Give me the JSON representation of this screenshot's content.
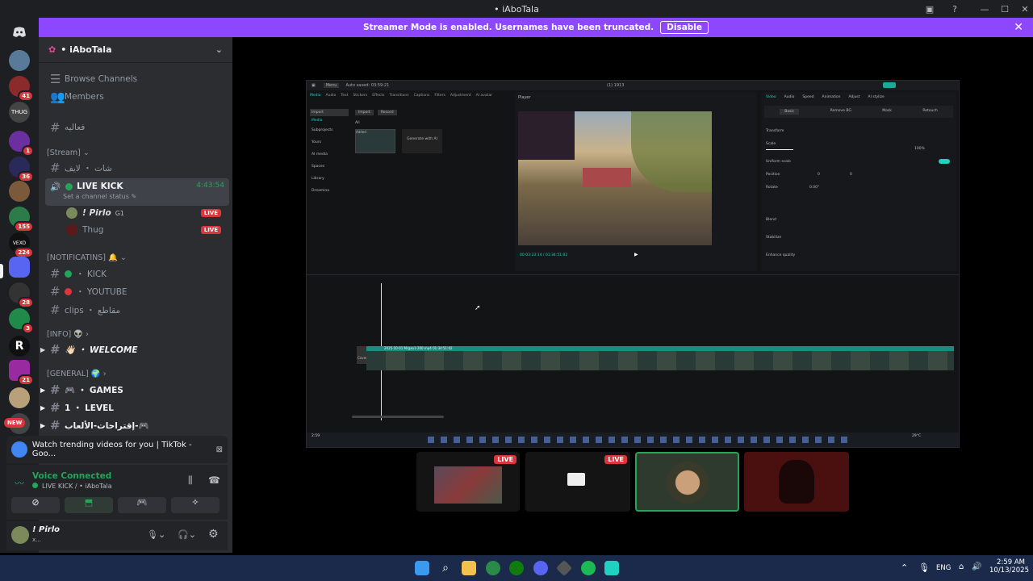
{
  "window": {
    "title": "• iAboTala"
  },
  "banner": {
    "text": "Streamer Mode is enabled. Usernames have been truncated.",
    "disable_label": "Disable",
    "color": "#8c47ff"
  },
  "guild_badges": [
    "41",
    "1",
    "36",
    "155",
    "224",
    "28",
    "3",
    "21",
    "NEW"
  ],
  "server": {
    "name": "• iAboTala"
  },
  "nav": {
    "browse": "Browse Channels",
    "members": "Members"
  },
  "channels": {
    "c1": "فعاليه",
    "stream_cat": "[Stream]",
    "c2": "شات ・ لايف",
    "live_kick": "LIVE KICK",
    "live_time": "4:43:54",
    "status_hint": "Set a channel status",
    "user1": "! Pirlo",
    "user1_tag": "G1",
    "user2": "Thug",
    "live_label": "LIVE",
    "notif_cat": "[NOTIFICATINS] 🔔",
    "kick": "・ KICK",
    "youtube": "・ YOUTUBE",
    "clips": "clips ・ مقاطع",
    "info_cat": "[INFO] 👽",
    "welcome": "👋🏻 ・ WELCOME",
    "general_cat": "[GENERAL] 🌍",
    "games": "🎮 ・ GAMES",
    "level": "1 ・ LEVEL",
    "suggest": "إقتراحات-الألعاب-🎮"
  },
  "activity": {
    "text": "Watch trending videos for you | TikTok - Goo..."
  },
  "voice": {
    "status": "Voice Connected",
    "channel": "LIVE KICK / • iAboTala"
  },
  "user": {
    "name": "! Pirlo",
    "sub": "x..."
  },
  "stream": {
    "app_title": "(1) 1913",
    "menu": "Menu",
    "autosaved": "Auto saved: 03:59:21",
    "player_label": "Player",
    "timecode": "00:03:23:14 / 01:34:51:02",
    "tabs": [
      "Video",
      "Audio",
      "Speed",
      "Animation",
      "Adjust",
      "AI stylize"
    ],
    "sub_tabs": [
      "Basic",
      "Remove BG",
      "Mask",
      "Retouch"
    ],
    "props": [
      "Transform",
      "Scale",
      "Uniform scale",
      "Position",
      "Rotate",
      "Blend",
      "Stabilize",
      "Enhance quality"
    ],
    "scale_val": "100%",
    "rotate_val": "0.00°",
    "pos_x": "0",
    "pos_y": "0",
    "top_tabs": [
      "Media",
      "Audio",
      "Text",
      "Stickers",
      "Effects",
      "Transitions",
      "Captions",
      "Filters",
      "Adjustment",
      "AI avatar"
    ],
    "left_items": [
      "Import",
      "Media",
      "Subprojects",
      "Yours",
      "AI media",
      "Spaces",
      "Library",
      "Dreamina"
    ],
    "import_btn": "Import",
    "record_btn": "Record",
    "all_label": "All",
    "added_label": "Added",
    "generate_label": "Generate with AI",
    "clip_label": "2025-10-01 Mrgao1-200.mp4   01:34:51:02",
    "cover_label": "Cover",
    "temp": "29°C",
    "time_small": "2:59"
  },
  "participants": [
    {
      "live": "LIVE"
    },
    {
      "live": "LIVE"
    },
    {},
    {}
  ],
  "taskbar": {
    "lang": "ENG",
    "time": "2:59 AM",
    "date": "10/13/2025"
  }
}
